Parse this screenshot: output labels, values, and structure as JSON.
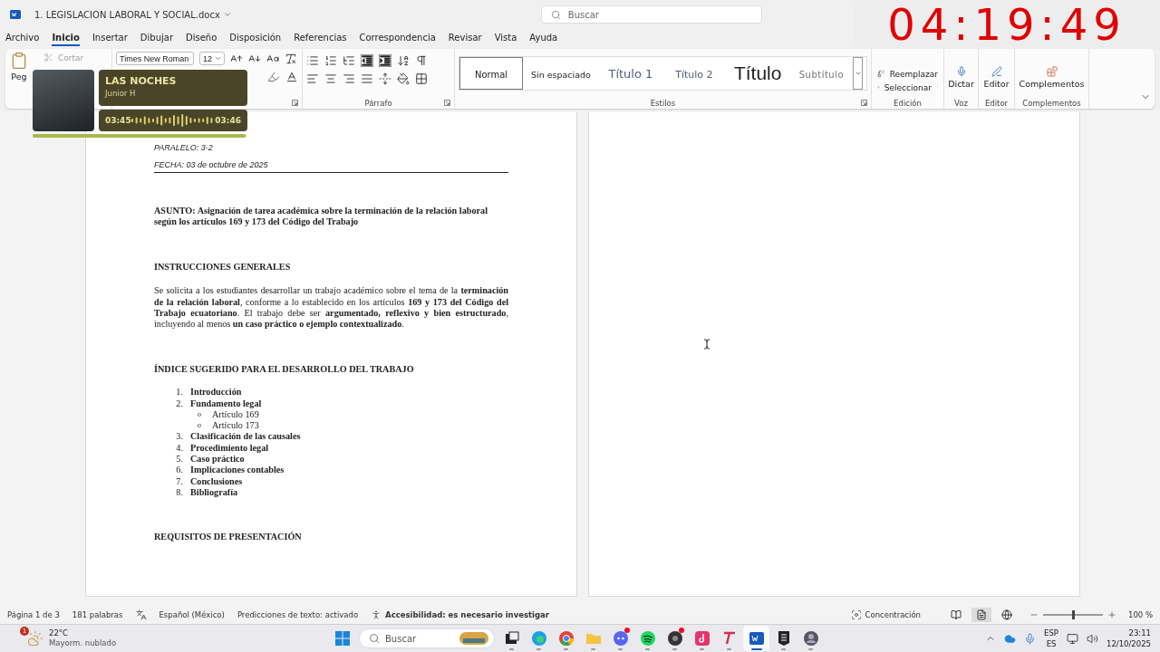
{
  "window": {
    "title": "1. LEGISLACION LABORAL Y SOCIAL.docx",
    "search_placeholder": "Buscar"
  },
  "clock": {
    "time": "04:19:49"
  },
  "ribbon_tabs": [
    {
      "label": "Archivo",
      "selected": false
    },
    {
      "label": "Inicio",
      "selected": true
    },
    {
      "label": "Insertar",
      "selected": false
    },
    {
      "label": "Dibujar",
      "selected": false
    },
    {
      "label": "Diseño",
      "selected": false
    },
    {
      "label": "Disposición",
      "selected": false
    },
    {
      "label": "Referencias",
      "selected": false
    },
    {
      "label": "Correspondencia",
      "selected": false
    },
    {
      "label": "Revisar",
      "selected": false
    },
    {
      "label": "Vista",
      "selected": false
    },
    {
      "label": "Ayuda",
      "selected": false
    }
  ],
  "ribbon": {
    "clipboard": {
      "paste": "Peg",
      "cut": "Cortar",
      "cut_disabled": true
    },
    "font": {
      "name": "Times New Roman",
      "size": "12"
    },
    "paragraph": {
      "label": "Párrafo"
    },
    "styles": {
      "label": "Estilos",
      "items": [
        {
          "label": "Normal",
          "kind": "normal",
          "selected": true
        },
        {
          "label": "Sin espaciado",
          "kind": "no-spacing",
          "selected": false
        },
        {
          "label": "Título 1",
          "kind": "heading1",
          "selected": false
        },
        {
          "label": "Título 2",
          "kind": "heading2",
          "selected": false
        },
        {
          "label": "Título",
          "kind": "title",
          "selected": false
        },
        {
          "label": "Subtítulo",
          "kind": "subtitle",
          "selected": false
        }
      ]
    },
    "editing": {
      "label": "Edición",
      "replace": "Reemplazar",
      "select": "Seleccionar"
    },
    "voice": {
      "button": "Dictar",
      "label": "Voz"
    },
    "editor": {
      "button": "Editor",
      "label": "Editor"
    },
    "addins": {
      "button": "Complementos",
      "label": "Complementos"
    }
  },
  "music_player": {
    "title": "LAS NOCHES",
    "artist": "Junior H",
    "elapsed": "03:45",
    "total": "03:46",
    "level": 0.99
  },
  "document": {
    "blocks": [
      {
        "kind": "meta",
        "text": "PARALELO: 3-2"
      },
      {
        "kind": "meta",
        "text": "FECHA: 03 de octubre de 2025"
      },
      {
        "kind": "rule"
      },
      {
        "kind": "subject",
        "text": "ASUNTO: Asignación de tarea académica sobre la terminación de la relación laboral según los artículos 169 y 173 del Código del Trabajo"
      },
      {
        "kind": "heading",
        "text": "INSTRUCCIONES GENERALES"
      },
      {
        "kind": "paragraph",
        "text": "Se solicita a los estudiantes desarrollar un trabajo académico sobre el tema de la **terminación de la relación laboral**, conforme a lo establecido en los artículos **169 y 173 del Código del Trabajo ecuatoriano**. El trabajo debe ser **argumentado, reflexivo y bien estructurado**, incluyendo al menos **un caso práctico o ejemplo contextualizado**."
      },
      {
        "kind": "heading",
        "text": "ÍNDICE SUGERIDO PARA EL DESARROLLO DEL TRABAJO"
      },
      {
        "kind": "list",
        "items": [
          {
            "marker": "1.",
            "text": "Introducción"
          },
          {
            "marker": "2.",
            "text": "Fundamento legal",
            "children": [
              {
                "marker": "o",
                "text": "Artículo 169"
              },
              {
                "marker": "o",
                "text": "Artículo 173"
              }
            ]
          },
          {
            "marker": "3.",
            "text": "Clasificación de las causales"
          },
          {
            "marker": "4.",
            "text": "Procedimiento legal"
          },
          {
            "marker": "5.",
            "text": "Caso práctico"
          },
          {
            "marker": "6.",
            "text": "Implicaciones contables"
          },
          {
            "marker": "7.",
            "text": "Conclusiones"
          },
          {
            "marker": "8.",
            "text": "Bibliografía"
          }
        ]
      },
      {
        "kind": "heading",
        "text": "REQUISITOS DE PRESENTACIÓN"
      }
    ]
  },
  "status_bar": {
    "page": "Página 1 de 3",
    "words": "181 palabras",
    "language": "Español (México)",
    "predictions": "Predicciones de texto: activado",
    "accessibility": "Accesibilidad: es necesario investigar",
    "focus": "Concentración",
    "views": [
      {
        "kind": "read",
        "selected": false
      },
      {
        "kind": "print",
        "selected": true
      },
      {
        "kind": "web",
        "selected": false
      }
    ],
    "zoom": {
      "level": 0.5,
      "reading": "100 %"
    }
  },
  "taskbar": {
    "weather": {
      "temperature": "22°C",
      "condition": "Mayorm. nublado",
      "badge": "1"
    },
    "search_placeholder": "Buscar",
    "apps": [
      {
        "kind": "task-view",
        "selected": false,
        "badge": false
      },
      {
        "kind": "edge",
        "selected": false,
        "badge": false
      },
      {
        "kind": "chrome",
        "selected": false,
        "badge": false
      },
      {
        "kind": "folder",
        "selected": false,
        "badge": false
      },
      {
        "kind": "chat",
        "selected": false,
        "badge": true
      },
      {
        "kind": "music",
        "selected": false,
        "badge": false
      },
      {
        "kind": "recorder",
        "selected": false,
        "badge": true
      },
      {
        "kind": "video",
        "selected": false,
        "badge": false
      },
      {
        "kind": "text",
        "selected": false,
        "badge": false
      },
      {
        "kind": "word",
        "selected": true,
        "badge": false
      },
      {
        "kind": "store",
        "selected": false,
        "badge": false
      },
      {
        "kind": "avatar",
        "selected": false,
        "badge": false
      }
    ],
    "language": "ESP",
    "layout": "ES",
    "time": "23:11",
    "date": "12/10/2025"
  }
}
